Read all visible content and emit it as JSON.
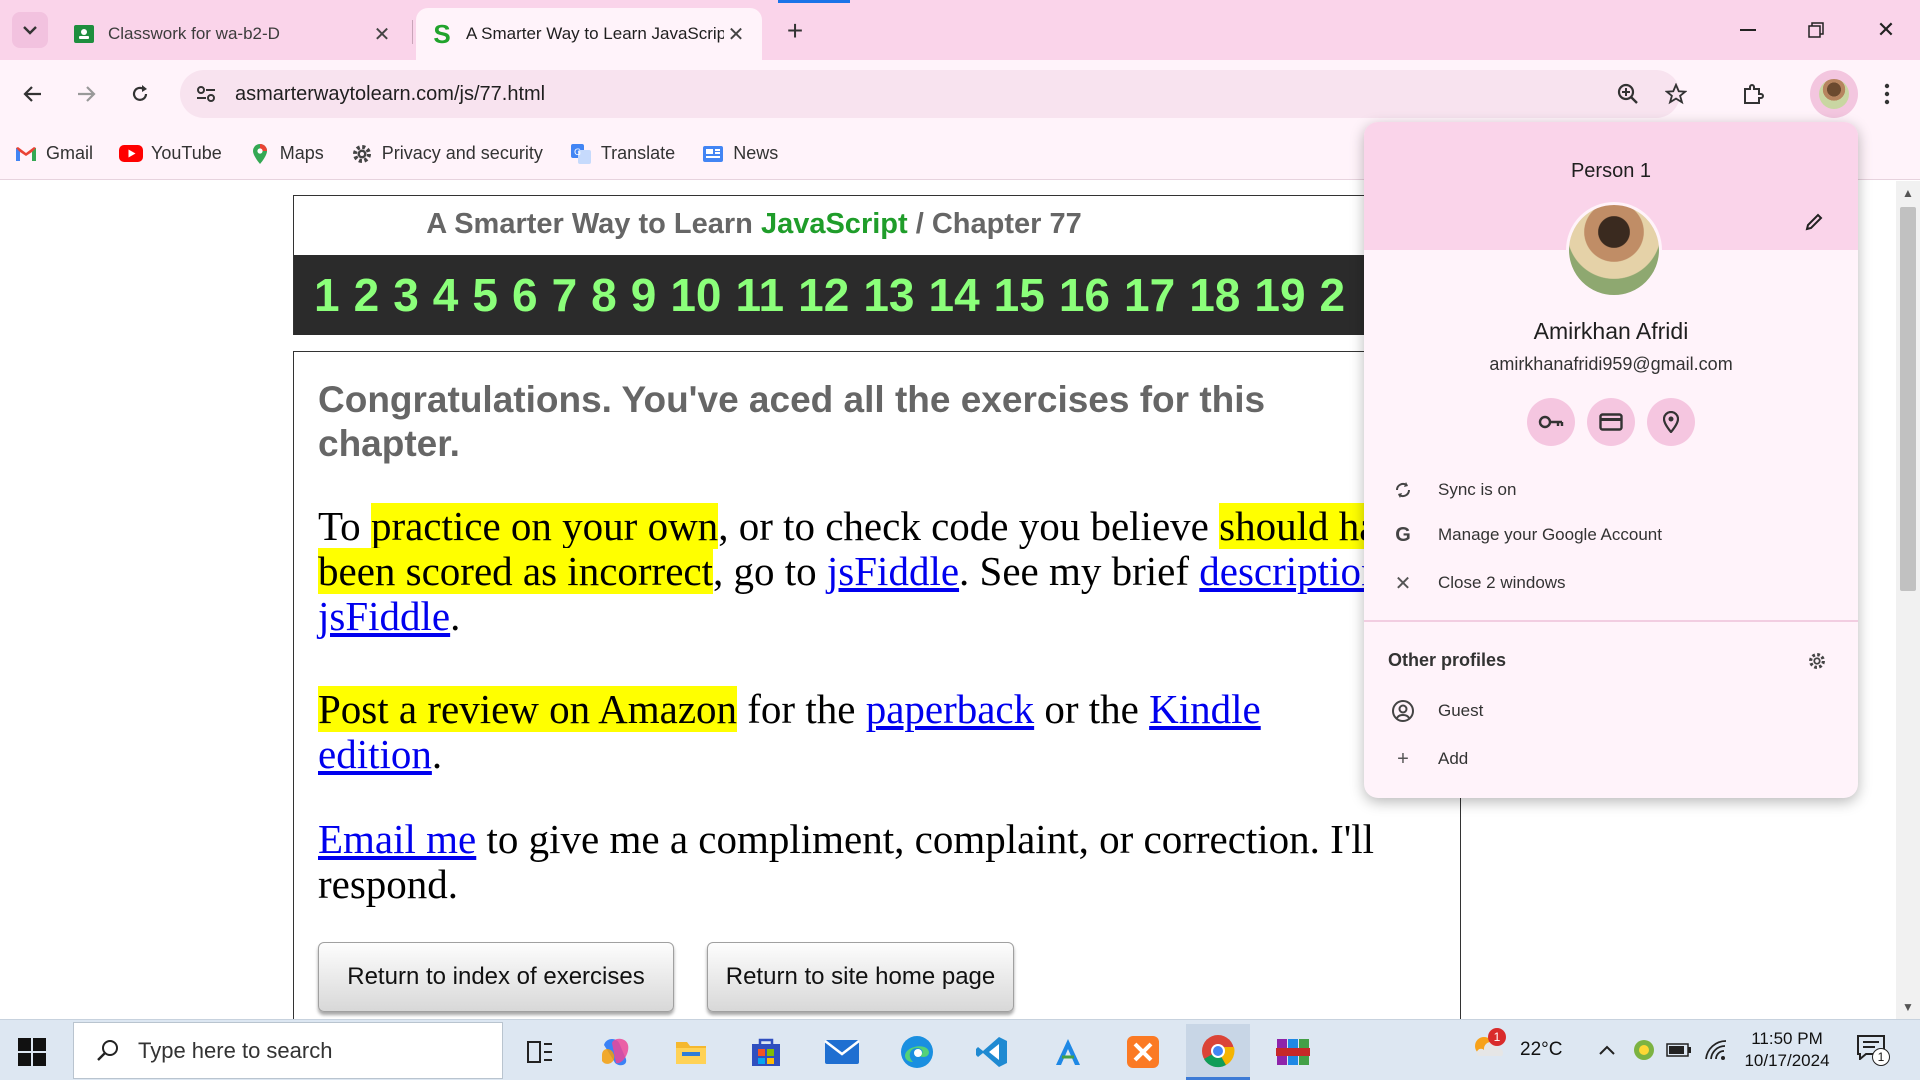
{
  "tabs": [
    {
      "title": "Classwork for wa-b2-D",
      "favicon": "google-classroom-icon"
    },
    {
      "title": "A Smarter Way to Learn JavaScript",
      "favicon": "smarter-way-s-icon"
    }
  ],
  "toolbar": {
    "url": "asmarterwaytolearn.com/js/77.html"
  },
  "bookmarks": [
    {
      "label": "Gmail",
      "icon": "gmail-icon"
    },
    {
      "label": "YouTube",
      "icon": "youtube-icon"
    },
    {
      "label": "Maps",
      "icon": "maps-icon"
    },
    {
      "label": "Privacy and security",
      "icon": "gear-icon"
    },
    {
      "label": "Translate",
      "icon": "translate-icon"
    },
    {
      "label": "News",
      "icon": "news-icon"
    }
  ],
  "page": {
    "title_prefix": "A Smarter Way to Learn ",
    "title_js": "JavaScript",
    "title_suffix": " / Chapter 77",
    "chapters": [
      "1",
      "2",
      "3",
      "4",
      "5",
      "6",
      "7",
      "8",
      "9",
      "10",
      "11",
      "12",
      "13",
      "14",
      "15",
      "16",
      "17",
      "18",
      "19",
      "2"
    ],
    "congrats": "Congratulations. You've aced all the exercises for this chapter.",
    "p1": {
      "t1": "To ",
      "h1": "practice on your own",
      "t2": ", or to check code you believe ",
      "h2": "should have been scored as incorrect",
      "t3": ", go to ",
      "link1": "jsFiddle",
      "t4": ". See my brief ",
      "link2": "description of jsFiddle",
      "t5": "."
    },
    "p2": {
      "h1": "Post a review on Amazon",
      "t1": " for the ",
      "link1": "paperback",
      "t2": " or the ",
      "link2": "Kindle edition",
      "t3": "."
    },
    "p3": {
      "link1": "Email me",
      "t1": " to give me a compliment, complaint, or correction. I'll respond."
    },
    "btn_index": "Return to index of exercises",
    "btn_home": "Return to site home page"
  },
  "profile": {
    "header": "Person 1",
    "name": "Amirkhan Afridi",
    "email": "amirkhanafridi959@gmail.com",
    "quick_icons": [
      "key-icon",
      "credit-card-icon",
      "location-pin-icon"
    ],
    "sync": "Sync is on",
    "manage": "Manage your Google Account",
    "close_windows": "Close 2 windows",
    "other_profiles": "Other profiles",
    "guest": "Guest",
    "add": "Add"
  },
  "taskbar": {
    "search_placeholder": "Type here to search",
    "weather": "22°C",
    "time": "11:50 PM",
    "date": "10/17/2024",
    "notification_count": "1",
    "weather_badge": "1"
  },
  "colors": {
    "tabstrip": "#fad4ea",
    "toolbar": "#fff3fa",
    "highlight": "#ffff00",
    "chapter_digits": "#8bff7a",
    "javascript_green": "#1f9d2a",
    "link": "#0000ee"
  }
}
